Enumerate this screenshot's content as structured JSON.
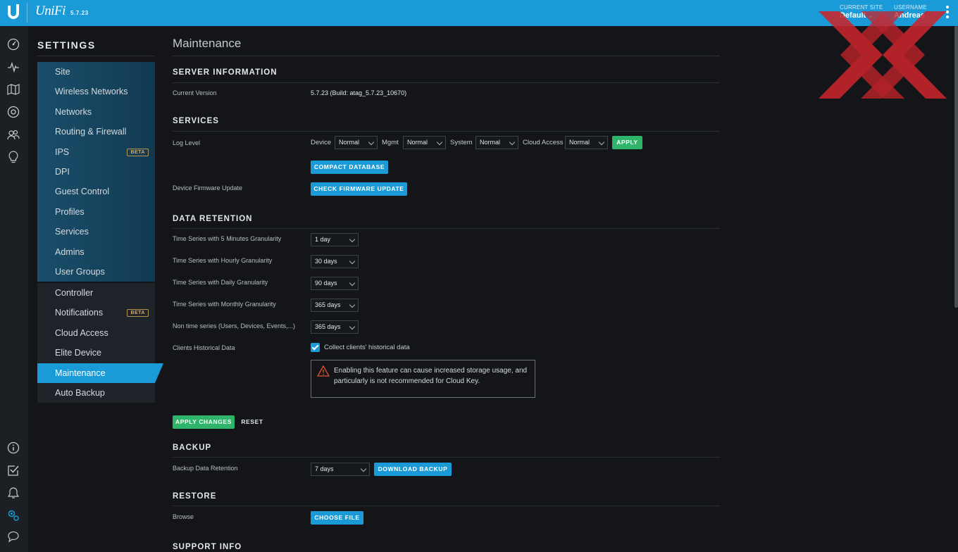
{
  "header": {
    "brand": "UniFi",
    "version": "5.7.23",
    "current_site_label": "CURRENT SITE",
    "current_site_value": "Default",
    "username_label": "USERNAME",
    "username_value": "Andreas"
  },
  "rail_icons": [
    "dashboard-icon",
    "statistics-icon",
    "map-icon",
    "devices-icon",
    "clients-icon",
    "insights-icon",
    "about-icon",
    "tasks-icon",
    "alerts-icon",
    "settings-icon",
    "chat-icon"
  ],
  "sidebar": {
    "title": "SETTINGS",
    "group_a": [
      {
        "label": "Site"
      },
      {
        "label": "Wireless Networks"
      },
      {
        "label": "Networks"
      },
      {
        "label": "Routing & Firewall"
      },
      {
        "label": "IPS",
        "badge": "BETA"
      },
      {
        "label": "DPI"
      },
      {
        "label": "Guest Control"
      },
      {
        "label": "Profiles"
      },
      {
        "label": "Services"
      },
      {
        "label": "Admins"
      },
      {
        "label": "User Groups"
      }
    ],
    "group_b": [
      {
        "label": "Controller"
      },
      {
        "label": "Notifications",
        "badge": "BETA"
      },
      {
        "label": "Cloud Access"
      },
      {
        "label": "Elite Device"
      },
      {
        "label": "Maintenance",
        "active": true
      },
      {
        "label": "Auto Backup"
      }
    ]
  },
  "main": {
    "title": "Maintenance",
    "server_info": {
      "heading": "SERVER INFORMATION",
      "current_version_label": "Current Version",
      "current_version_value": "5.7.23 (Build: atag_5.7.23_10670)"
    },
    "services": {
      "heading": "SERVICES",
      "log_level_label": "Log Level",
      "device_label": "Device",
      "device_value": "Normal",
      "mgmt_label": "Mgmt",
      "mgmt_value": "Normal",
      "system_label": "System",
      "system_value": "Normal",
      "cloud_access_label": "Cloud Access",
      "cloud_access_value": "Normal",
      "apply_label": "APPLY",
      "compact_db_label": "COMPACT DATABASE",
      "firmware_label": "Device Firmware Update",
      "check_firmware_label": "CHECK FIRMWARE UPDATE"
    },
    "data_retention": {
      "heading": "DATA RETENTION",
      "rows": [
        {
          "label": "Time Series with 5 Minutes Granularity",
          "value": "1 day"
        },
        {
          "label": "Time Series with Hourly Granularity",
          "value": "30 days"
        },
        {
          "label": "Time Series with Daily Granularity",
          "value": "90 days"
        },
        {
          "label": "Time Series with Monthly Granularity",
          "value": "365 days"
        },
        {
          "label": "Non time series (Users, Devices, Events,...)",
          "value": "365 days"
        }
      ],
      "clients_hist_label": "Clients Historical Data",
      "clients_hist_checkbox_label": "Collect clients' historical data",
      "clients_hist_checked": true,
      "warning_text": "Enabling this feature can cause increased storage usage, and particularly is not recommended for Cloud Key.",
      "apply_changes_label": "APPLY CHANGES",
      "reset_label": "RESET"
    },
    "backup": {
      "heading": "BACKUP",
      "retention_label": "Backup Data Retention",
      "retention_value": "7 days",
      "download_label": "DOWNLOAD BACKUP"
    },
    "restore": {
      "heading": "RESTORE",
      "browse_label": "Browse",
      "choose_file_label": "CHOOSE FILE"
    },
    "support_info": {
      "heading": "SUPPORT INFO"
    }
  },
  "colors": {
    "accent": "#1a9bd7",
    "success": "#2fb56a",
    "background": "#131519"
  }
}
